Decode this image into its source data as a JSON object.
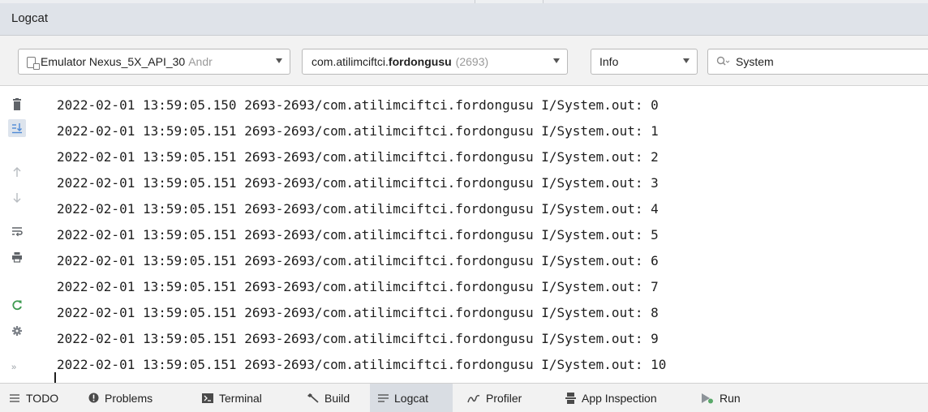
{
  "window": {
    "title": "Logcat"
  },
  "filters": {
    "device": {
      "label": "Emulator Nexus_5X_API_30",
      "suffix": "Andr"
    },
    "process": {
      "prefix": "com.atilimciftci.",
      "bold": "fordongusu",
      "pid": "(2693)"
    },
    "level": {
      "value": "Info"
    },
    "search": {
      "value": "System"
    }
  },
  "sidebar": {
    "icons": [
      "trash-icon",
      "scroll-to-end-icon",
      "arrow-up-icon",
      "arrow-down-icon",
      "soft-wrap-icon",
      "print-icon",
      "restart-icon",
      "settings-icon"
    ],
    "more": "»"
  },
  "log_lines": [
    "2022-02-01 13:59:05.150 2693-2693/com.atilimciftci.fordongusu I/System.out: 0",
    "2022-02-01 13:59:05.151 2693-2693/com.atilimciftci.fordongusu I/System.out: 1",
    "2022-02-01 13:59:05.151 2693-2693/com.atilimciftci.fordongusu I/System.out: 2",
    "2022-02-01 13:59:05.151 2693-2693/com.atilimciftci.fordongusu I/System.out: 3",
    "2022-02-01 13:59:05.151 2693-2693/com.atilimciftci.fordongusu I/System.out: 4",
    "2022-02-01 13:59:05.151 2693-2693/com.atilimciftci.fordongusu I/System.out: 5",
    "2022-02-01 13:59:05.151 2693-2693/com.atilimciftci.fordongusu I/System.out: 6",
    "2022-02-01 13:59:05.151 2693-2693/com.atilimciftci.fordongusu I/System.out: 7",
    "2022-02-01 13:59:05.151 2693-2693/com.atilimciftci.fordongusu I/System.out: 8",
    "2022-02-01 13:59:05.151 2693-2693/com.atilimciftci.fordongusu I/System.out: 9",
    "2022-02-01 13:59:05.151 2693-2693/com.atilimciftci.fordongusu I/System.out: 10"
  ],
  "bottom_tabs": [
    {
      "label": "TODO",
      "icon": "list-icon"
    },
    {
      "label": "Problems",
      "icon": "problems-icon"
    },
    {
      "label": "Terminal",
      "icon": "terminal-icon"
    },
    {
      "label": "Build",
      "icon": "hammer-icon"
    },
    {
      "label": "Logcat",
      "icon": "logcat-icon",
      "active": true
    },
    {
      "label": "Profiler",
      "icon": "profiler-icon"
    },
    {
      "label": "App Inspection",
      "icon": "app-inspection-icon"
    },
    {
      "label": "Run",
      "icon": "run-icon"
    }
  ],
  "colors": {
    "accent_active_tab": "#d9dde3",
    "run_green": "#59a869",
    "restart_green": "#3d9a50"
  }
}
